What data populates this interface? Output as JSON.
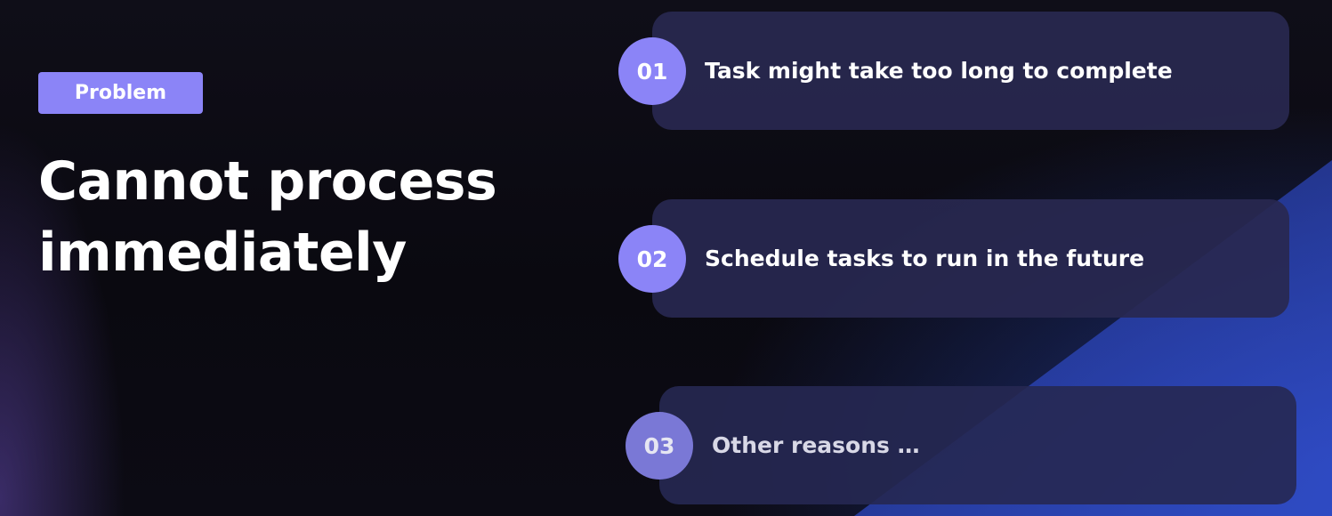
{
  "badge": {
    "label": "Problem"
  },
  "heading": {
    "line1": "Cannot process",
    "line2": "immediately"
  },
  "items": [
    {
      "number": "01",
      "text": "Task might take too long to complete"
    },
    {
      "number": "02",
      "text": "Schedule tasks to run in the future"
    },
    {
      "number": "03",
      "text": "Other reasons …"
    }
  ],
  "colors": {
    "accent": "#8b84f7",
    "card": "#282850",
    "background": "#0b0a12"
  }
}
